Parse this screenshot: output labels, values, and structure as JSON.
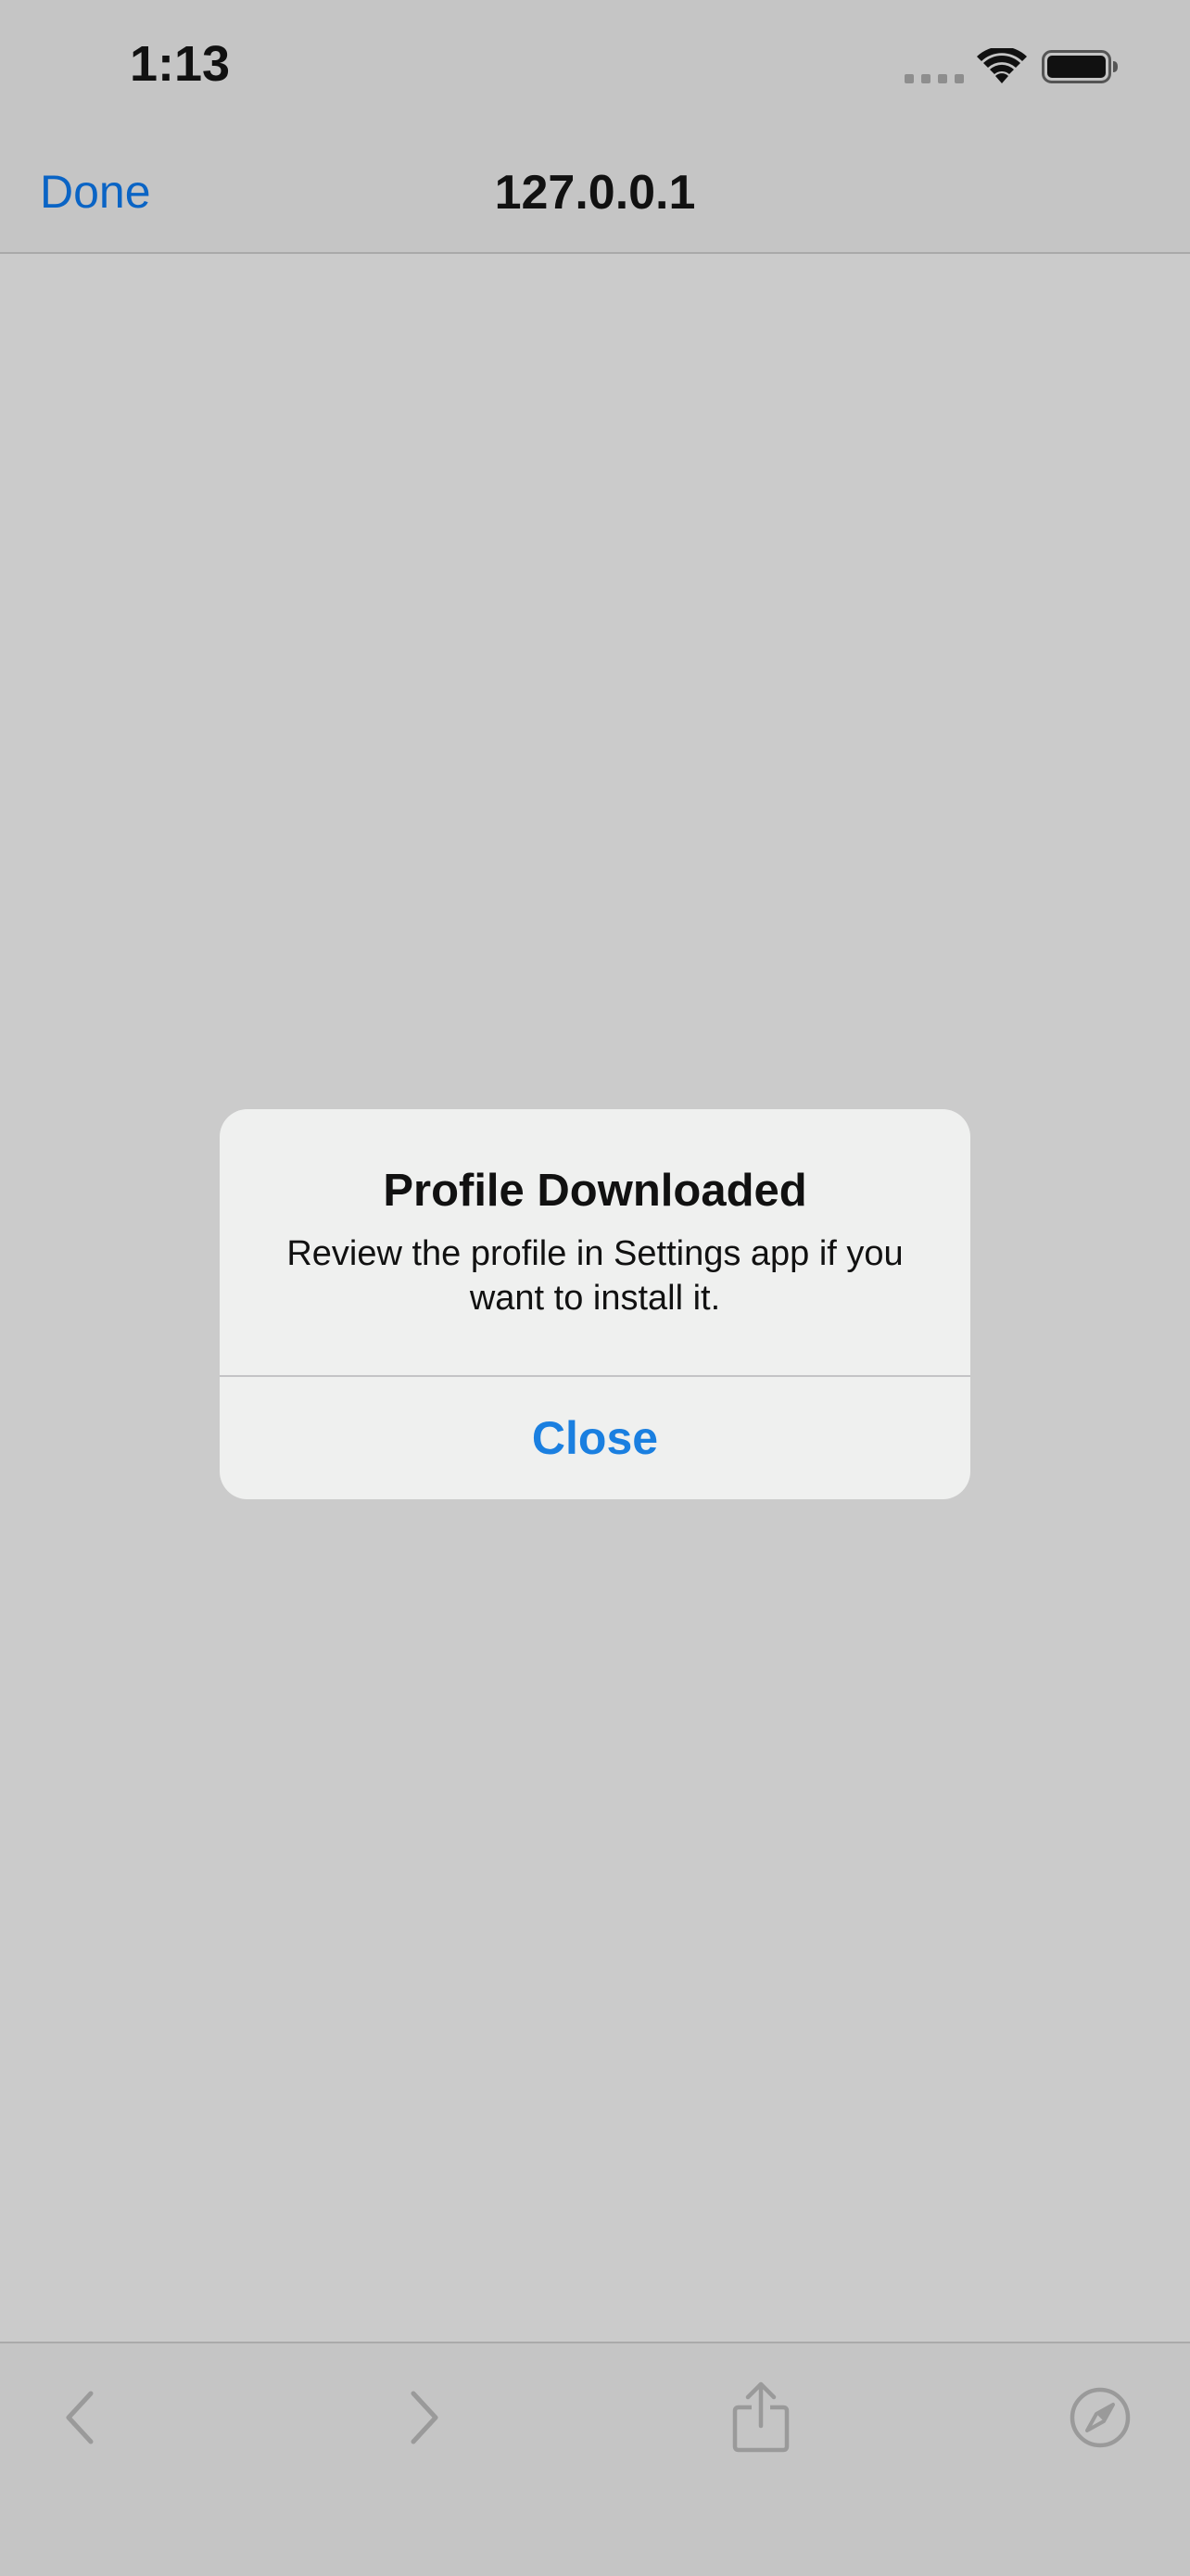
{
  "status_bar": {
    "time": "1:13"
  },
  "nav": {
    "done_label": "Done",
    "title": "127.0.0.1"
  },
  "alert": {
    "title": "Profile Downloaded",
    "message": "Review the profile in Settings app if you want to install it.",
    "close_label": "Close"
  },
  "toolbar": {
    "icons": [
      "chevron-left-icon",
      "chevron-right-icon",
      "share-icon",
      "compass-icon"
    ]
  },
  "colors": {
    "accent": "#1a7fe0",
    "nav_link": "#0a64c5",
    "background": "#cbcbcb",
    "bar": "#c5c5c5",
    "alert_bg": "#eff0ef",
    "disabled_icon": "#9a9a9a"
  }
}
